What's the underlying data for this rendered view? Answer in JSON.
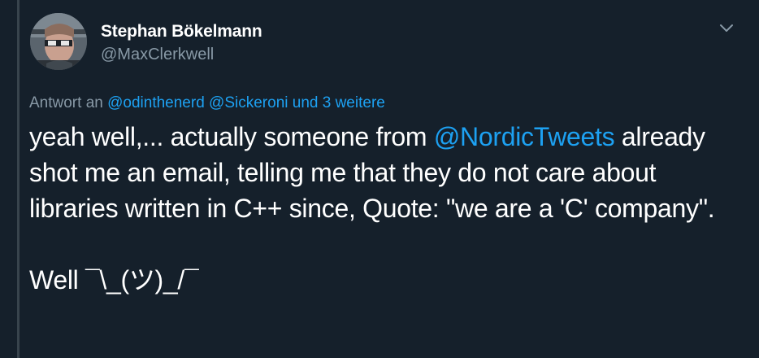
{
  "author": {
    "display_name": "Stephan Bökelmann",
    "handle": "@MaxClerkwell",
    "avatar_icon": "user-avatar"
  },
  "reply": {
    "prefix": "Antwort an",
    "mention_1": "@odinthenerd",
    "mention_2": "@Sickeroni",
    "suffix": "und 3 weitere"
  },
  "tweet": {
    "segment_1": "yeah well,... actually someone from ",
    "mention": "@NordicTweets",
    "segment_2": " already shot me an email, telling me that they do not care about libraries written in C++ since, Quote: \"we are a 'C' company\".",
    "segment_3": "Well ¯\\_(ツ)_/¯"
  },
  "menu_icon": "chevron-down-icon",
  "colors": {
    "background": "#15202b",
    "text": "#ffffff",
    "secondary": "#8899a6",
    "link": "#1da1f2",
    "thread_line": "#38444d"
  }
}
